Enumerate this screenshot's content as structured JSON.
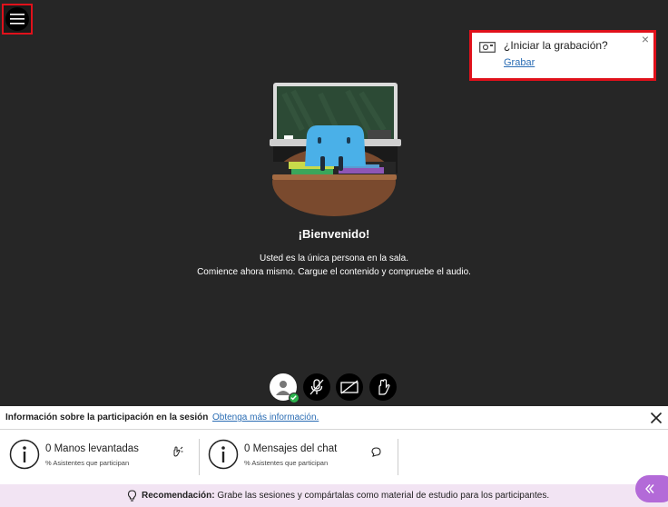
{
  "recording_popup": {
    "question": "¿Iniciar la grabación?",
    "link": "Grabar",
    "close": "×"
  },
  "welcome": {
    "title": "¡Bienvenido!",
    "line1": "Usted es la única persona en la sala.",
    "line2": "Comience ahora mismo. Cargue el contenido y compruebe el audio."
  },
  "panel": {
    "title": "Información sobre la participación en la sesión",
    "more_link": "Obtenga más información.",
    "stats": [
      {
        "title": "0 Manos levantadas",
        "sub": "% Asistentes que participan",
        "icon": "hand-icon"
      },
      {
        "title": "0 Mensajes del chat",
        "sub": "% Asistentes que participan",
        "icon": "chat-icon"
      }
    ],
    "recommendation_label": "Recomendación:",
    "recommendation_text": " Grabe las sesiones y compártalas como material de estudio para los participantes."
  },
  "colors": {
    "background": "#262626",
    "highlight": "#e0111b",
    "link": "#2b6db4",
    "accent": "#b36ad8",
    "status_ok": "#2bb24c",
    "recommendation_bg": "#f2e4f3"
  },
  "controls": [
    "avatar",
    "microphone-off-icon",
    "camera-off-icon",
    "raise-hand-icon"
  ]
}
